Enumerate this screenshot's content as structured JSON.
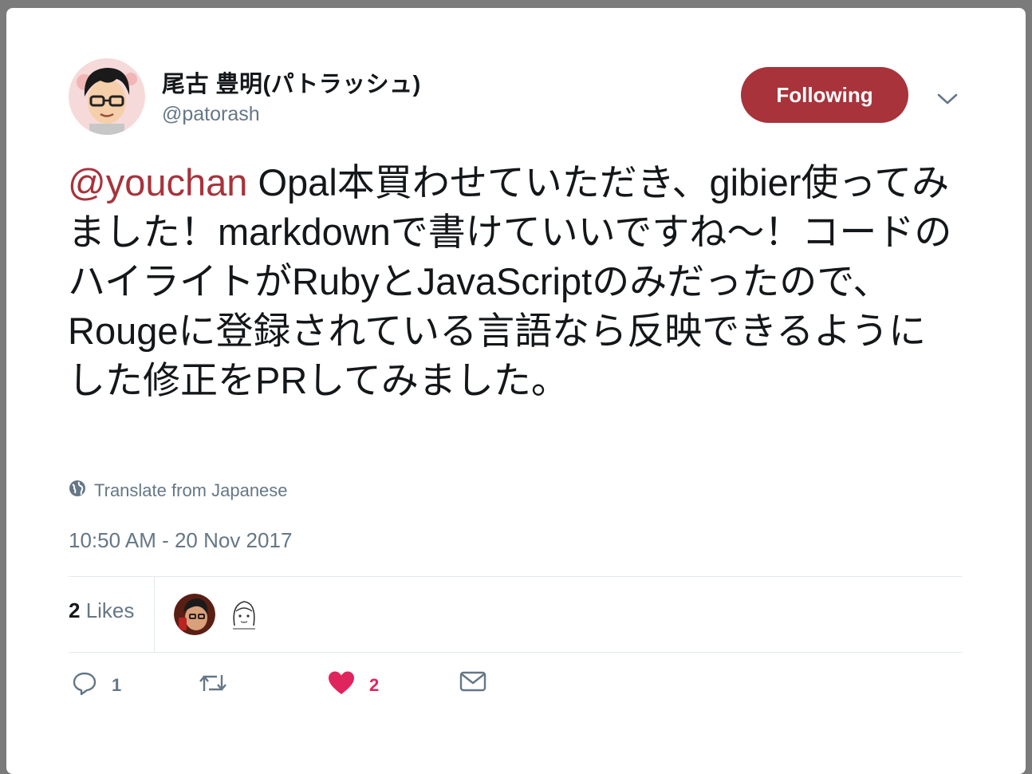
{
  "user": {
    "display_name": "尾古 豊明(パトラッシュ)",
    "handle": "@patorash"
  },
  "follow_button": {
    "label": "Following"
  },
  "tweet": {
    "mention": "@youchan",
    "body": " Opal本買わせていただき、gibier使ってみました！markdownで書けていいですね〜！コードのハイライトがRubyとJavaScriptのみだったので、Rougeに登録されている言語なら反映できるようにした修正をPRしてみました。"
  },
  "translate": {
    "label": "Translate from Japanese",
    "icon": "globe-icon"
  },
  "timestamp": "10:50 AM - 20 Nov 2017",
  "likes": {
    "count": "2",
    "label": " Likes"
  },
  "actions": {
    "reply_count": "1",
    "retweet_count": "",
    "like_count": "2"
  },
  "colors": {
    "accent": "#a8333b",
    "like": "#e0245e",
    "muted": "#657786",
    "text": "#14171a"
  }
}
